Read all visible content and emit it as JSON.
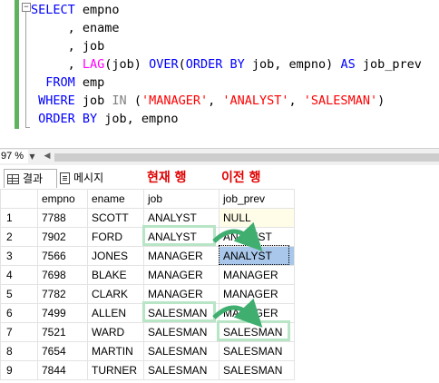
{
  "editor": {
    "lines": [
      {
        "parts": [
          {
            "t": "SELECT",
            "c": "kw"
          },
          {
            "t": " empno",
            "c": ""
          }
        ]
      },
      {
        "parts": [
          {
            "t": "     , ename",
            "c": ""
          }
        ]
      },
      {
        "parts": [
          {
            "t": "     , job",
            "c": ""
          }
        ]
      },
      {
        "parts": [
          {
            "t": "     , ",
            "c": ""
          },
          {
            "t": "LAG",
            "c": "fn"
          },
          {
            "t": "(job) ",
            "c": ""
          },
          {
            "t": "OVER",
            "c": "kw"
          },
          {
            "t": "(",
            "c": ""
          },
          {
            "t": "ORDER BY",
            "c": "kw"
          },
          {
            "t": " job, empno) ",
            "c": ""
          },
          {
            "t": "AS",
            "c": "kw"
          },
          {
            "t": " job_prev",
            "c": ""
          }
        ]
      },
      {
        "parts": [
          {
            "t": "  FROM",
            "c": "kw"
          },
          {
            "t": " emp",
            "c": ""
          }
        ]
      },
      {
        "parts": [
          {
            "t": " WHERE",
            "c": "kw"
          },
          {
            "t": " job ",
            "c": ""
          },
          {
            "t": "IN",
            "c": "op"
          },
          {
            "t": " (",
            "c": ""
          },
          {
            "t": "'MANAGER'",
            "c": "str"
          },
          {
            "t": ", ",
            "c": ""
          },
          {
            "t": "'ANALYST'",
            "c": "str"
          },
          {
            "t": ", ",
            "c": ""
          },
          {
            "t": "'SALESMAN'",
            "c": "str"
          },
          {
            "t": ")",
            "c": ""
          }
        ]
      },
      {
        "parts": [
          {
            "t": " ORDER BY",
            "c": "kw"
          },
          {
            "t": " job, empno",
            "c": ""
          }
        ]
      }
    ],
    "collapse_glyph": "−"
  },
  "zoom": {
    "level": "97 %",
    "arrow": "▼",
    "scroll_left": "◀"
  },
  "tabs": {
    "results_label": "결과",
    "messages_label": "메시지",
    "results_icon": "grid-icon",
    "messages_icon": "message-icon"
  },
  "annotations": {
    "current_row": "현재 행",
    "previous_row": "이전 행",
    "box_color": "#b7e5c6",
    "arrow_color": "#3fae6f"
  },
  "grid": {
    "columns": [
      "empno",
      "ename",
      "job",
      "job_prev"
    ],
    "rows": [
      {
        "n": "1",
        "empno": "7788",
        "ename": "SCOTT",
        "job": "ANALYST",
        "job_prev": "NULL"
      },
      {
        "n": "2",
        "empno": "7902",
        "ename": "FORD",
        "job": "ANALYST",
        "job_prev": "ANALYST"
      },
      {
        "n": "3",
        "empno": "7566",
        "ename": "JONES",
        "job": "MANAGER",
        "job_prev": "ANALYST"
      },
      {
        "n": "4",
        "empno": "7698",
        "ename": "BLAKE",
        "job": "MANAGER",
        "job_prev": "MANAGER"
      },
      {
        "n": "5",
        "empno": "7782",
        "ename": "CLARK",
        "job": "MANAGER",
        "job_prev": "MANAGER"
      },
      {
        "n": "6",
        "empno": "7499",
        "ename": "ALLEN",
        "job": "SALESMAN",
        "job_prev": "MANAGER"
      },
      {
        "n": "7",
        "empno": "7521",
        "ename": "WARD",
        "job": "SALESMAN",
        "job_prev": "SALESMAN"
      },
      {
        "n": "8",
        "empno": "7654",
        "ename": "MARTIN",
        "job": "SALESMAN",
        "job_prev": "SALESMAN"
      },
      {
        "n": "9",
        "empno": "7844",
        "ename": "TURNER",
        "job": "SALESMAN",
        "job_prev": "SALESMAN"
      }
    ],
    "null_cell_color": "#fffde8",
    "selected_cell_color": "#a8c7ea"
  }
}
